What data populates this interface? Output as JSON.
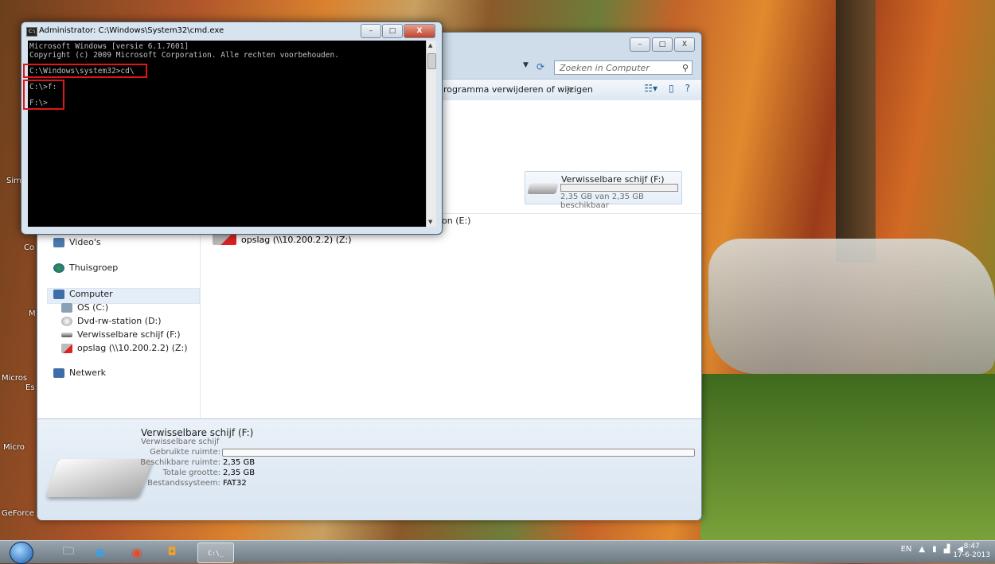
{
  "cmd": {
    "title": "Administrator: C:\\Windows\\System32\\cmd.exe",
    "lines": [
      "Microsoft Windows [versie 6.1.7601]",
      "Copyright (c) 2009 Microsoft Corporation. Alle rechten voorbehouden.",
      "C:\\Windows\\system32>cd\\",
      "C:\\>f:",
      "F:\\>"
    ],
    "buttons": {
      "minimize": "–",
      "maximize": "□",
      "close": "X"
    }
  },
  "explorer": {
    "buttons": {
      "minimize": "–",
      "maximize": "□",
      "close": "X"
    },
    "search_placeholder": "Zoeken in Computer",
    "toolbar_text": "rogramma verwijderen of wijzigen",
    "toolbar_more": "»",
    "nav": {
      "videos": "Video's",
      "homegroup": "Thuisgroep",
      "computer": "Computer",
      "os": "OS (C:)",
      "dvd": "Dvd-rw-station (D:)",
      "removable": "Verwisselbare schijf (F:)",
      "network_drive": "opslag (\\\\10.200.2.2) (Z:)",
      "network": "Netwerk"
    },
    "main": {
      "partial_drive": "on (E:)",
      "drive_f": {
        "name": "Verwisselbare schijf (F:)",
        "free": "2,35 GB van 2,35 GB beschikbaar",
        "used_fraction": 0.0
      },
      "network_drive": "opslag (\\\\10.200.2.2) (Z:)"
    },
    "details": {
      "title": "Verwisselbare schijf (F:)",
      "subtitle": "Verwisselbare schijf",
      "used_label": "Gebruikte ruimte:",
      "free_label": "Beschikbare ruimte:",
      "free_value": "2,35 GB",
      "total_label": "Totale grootte:",
      "total_value": "2,35 GB",
      "fs_label": "Bestandssysteem:",
      "fs_value": "FAT32"
    }
  },
  "desktop": {
    "labels": [
      "Sim",
      "Co",
      "M",
      "Micros",
      "Es",
      "Micro",
      "GeForce"
    ]
  },
  "taskbar": {
    "lang": "EN",
    "time": "8:47",
    "date": "17-6-2013",
    "cmd_glyph": "C:\\_"
  },
  "colors": {
    "highlight": "#e0151a",
    "console_bg": "#000000",
    "console_text": "#c0c0c0"
  }
}
